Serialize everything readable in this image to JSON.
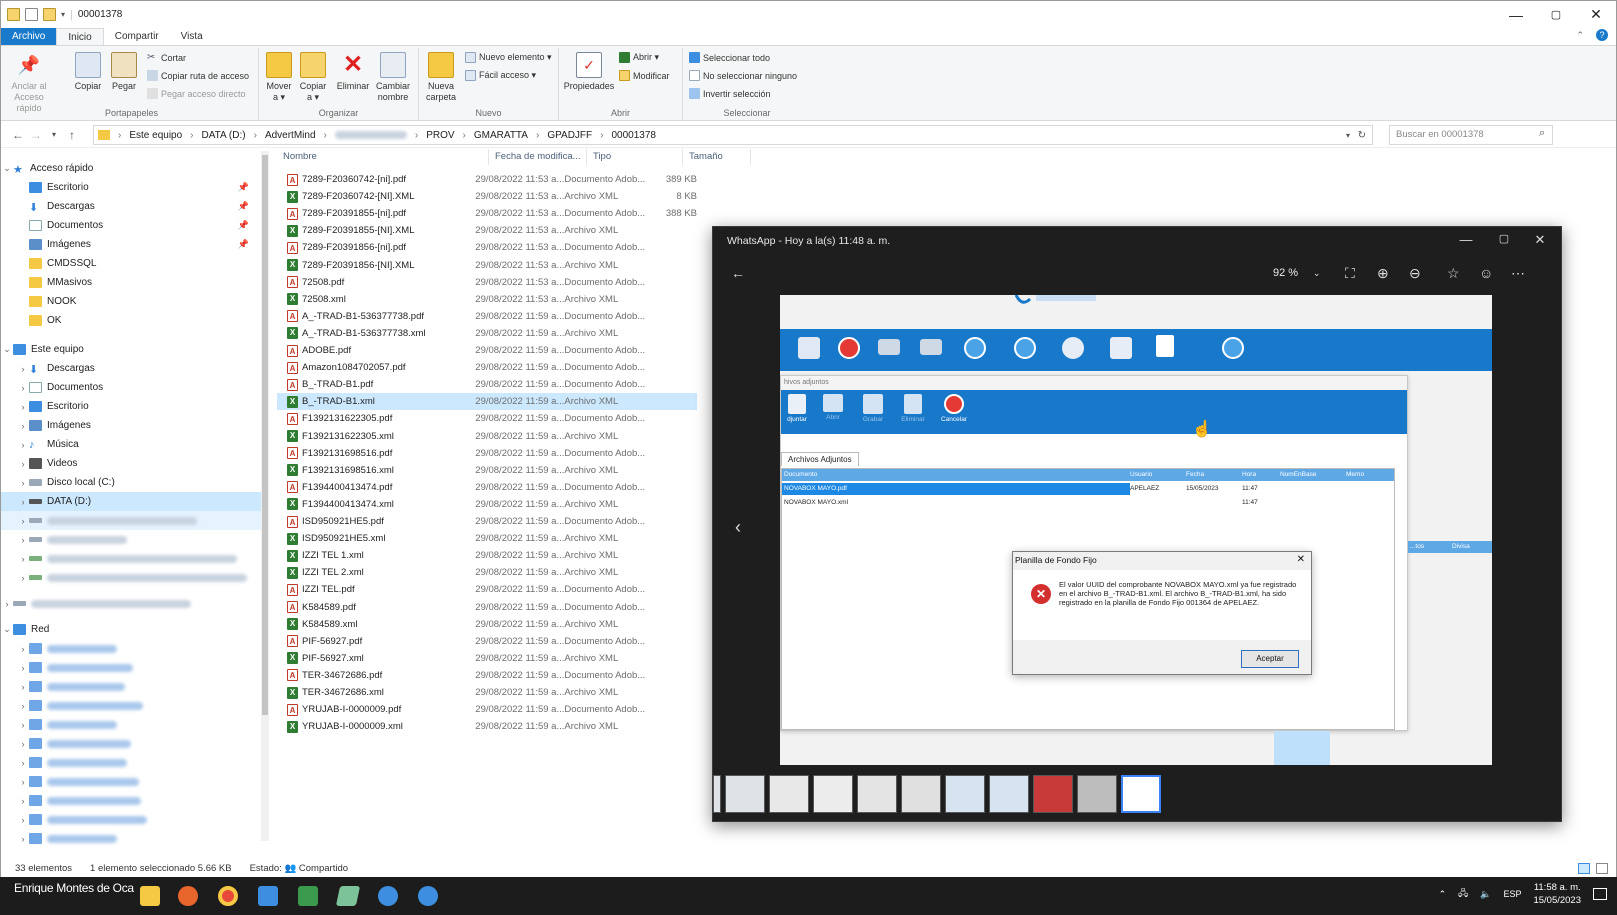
{
  "window": {
    "path_title": "00001378",
    "min": "—",
    "max": "▢",
    "close": "✕"
  },
  "ribbon_tabs": [
    "Archivo",
    "Inicio",
    "Compartir",
    "Vista"
  ],
  "ribbon": {
    "portapapeles": {
      "pin": "Anclar al Acceso rápido",
      "copy": "Copiar",
      "paste": "Pegar",
      "cut": "Cortar",
      "copy_path": "Copiar ruta de acceso",
      "paste_shortcut": "Pegar acceso directo",
      "label": "Portapapeles"
    },
    "organizar": {
      "move": "Mover a ▾",
      "copy_to": "Copiar a ▾",
      "delete": "Eliminar",
      "rename": "Cambiar nombre",
      "label": "Organizar"
    },
    "nuevo": {
      "new_folder": "Nueva carpeta",
      "new_item": "Nuevo elemento ▾",
      "easy_access": "Fácil acceso ▾",
      "label": "Nuevo"
    },
    "abrir": {
      "properties": "Propiedades",
      "open": "Abrir ▾",
      "modify": "Modificar",
      "label": "Abrir"
    },
    "seleccionar": {
      "select_all": "Seleccionar todo",
      "select_none": "No seleccionar ninguno",
      "invert": "Invertir selección",
      "label": "Seleccionar"
    }
  },
  "breadcrumb": [
    "Este equipo",
    "DATA (D:)",
    "AdvertMind",
    "PROV",
    "GMARATTA",
    "GPADJFF",
    "00001378"
  ],
  "search_placeholder": "Buscar en 00001378",
  "nav": {
    "quick_access": "Acceso rápido",
    "quick_items": [
      "Escritorio",
      "Descargas",
      "Documentos",
      "Imágenes",
      "CMDSSQL",
      "MMasivos",
      "NOOK",
      "OK"
    ],
    "this_pc": "Este equipo",
    "pc_items": [
      "Descargas",
      "Documentos",
      "Escritorio",
      "Imágenes",
      "Música",
      "Videos",
      "Disco local (C:)",
      "DATA (D:)"
    ],
    "network": "Red"
  },
  "columns": {
    "name": "Nombre",
    "date": "Fecha de modifica...",
    "type": "Tipo",
    "size": "Tamaño"
  },
  "files": [
    {
      "name": "7289-F20360742-[ni].pdf",
      "kind": "pdf",
      "date": "29/08/2022 11:53 a...",
      "type": "Documento Adob...",
      "size": "389 KB"
    },
    {
      "name": "7289-F20360742-[NI].XML",
      "kind": "xml",
      "date": "29/08/2022 11:53 a...",
      "type": "Archivo XML",
      "size": "8 KB"
    },
    {
      "name": "7289-F20391855-[ni].pdf",
      "kind": "pdf",
      "date": "29/08/2022 11:53 a...",
      "type": "Documento Adob...",
      "size": "388 KB"
    },
    {
      "name": "7289-F20391855-[NI].XML",
      "kind": "xml",
      "date": "29/08/2022 11:53 a...",
      "type": "Archivo XML",
      "size": ""
    },
    {
      "name": "7289-F20391856-[ni].pdf",
      "kind": "pdf",
      "date": "29/08/2022 11:53 a...",
      "type": "Documento Adob...",
      "size": ""
    },
    {
      "name": "7289-F20391856-[NI].XML",
      "kind": "xml",
      "date": "29/08/2022 11:53 a...",
      "type": "Archivo XML",
      "size": ""
    },
    {
      "name": "72508.pdf",
      "kind": "pdf",
      "date": "29/08/2022 11:53 a...",
      "type": "Documento Adob...",
      "size": ""
    },
    {
      "name": "72508.xml",
      "kind": "xml",
      "date": "29/08/2022 11:53 a...",
      "type": "Archivo XML",
      "size": ""
    },
    {
      "name": "A_-TRAD-B1-536377738.pdf",
      "kind": "pdf",
      "date": "29/08/2022 11:59 a...",
      "type": "Documento Adob...",
      "size": ""
    },
    {
      "name": "A_-TRAD-B1-536377738.xml",
      "kind": "xml",
      "date": "29/08/2022 11:59 a...",
      "type": "Archivo XML",
      "size": ""
    },
    {
      "name": "ADOBE.pdf",
      "kind": "pdf",
      "date": "29/08/2022 11:59 a...",
      "type": "Documento Adob...",
      "size": ""
    },
    {
      "name": "Amazon1084702057.pdf",
      "kind": "pdf",
      "date": "29/08/2022 11:59 a...",
      "type": "Documento Adob...",
      "size": ""
    },
    {
      "name": "B_-TRAD-B1.pdf",
      "kind": "pdf",
      "date": "29/08/2022 11:59 a...",
      "type": "Documento Adob...",
      "size": ""
    },
    {
      "name": "B_-TRAD-B1.xml",
      "kind": "xml",
      "date": "29/08/2022 11:59 a...",
      "type": "Archivo XML",
      "size": "",
      "selected": true
    },
    {
      "name": "F1392131622305.pdf",
      "kind": "pdf",
      "date": "29/08/2022 11:59 a...",
      "type": "Documento Adob...",
      "size": ""
    },
    {
      "name": "F1392131622305.xml",
      "kind": "xml",
      "date": "29/08/2022 11:59 a...",
      "type": "Archivo XML",
      "size": ""
    },
    {
      "name": "F1392131698516.pdf",
      "kind": "pdf",
      "date": "29/08/2022 11:59 a...",
      "type": "Documento Adob...",
      "size": ""
    },
    {
      "name": "F1392131698516.xml",
      "kind": "xml",
      "date": "29/08/2022 11:59 a...",
      "type": "Archivo XML",
      "size": ""
    },
    {
      "name": "F1394400413474.pdf",
      "kind": "pdf",
      "date": "29/08/2022 11:59 a...",
      "type": "Documento Adob...",
      "size": ""
    },
    {
      "name": "F1394400413474.xml",
      "kind": "xml",
      "date": "29/08/2022 11:59 a...",
      "type": "Archivo XML",
      "size": ""
    },
    {
      "name": "ISD950921HE5.pdf",
      "kind": "pdf",
      "date": "29/08/2022 11:59 a...",
      "type": "Documento Adob...",
      "size": ""
    },
    {
      "name": "ISD950921HE5.xml",
      "kind": "xml",
      "date": "29/08/2022 11:59 a...",
      "type": "Archivo XML",
      "size": ""
    },
    {
      "name": "IZZI TEL 1.xml",
      "kind": "xml",
      "date": "29/08/2022 11:59 a...",
      "type": "Archivo XML",
      "size": ""
    },
    {
      "name": "IZZI TEL 2.xml",
      "kind": "xml",
      "date": "29/08/2022 11:59 a...",
      "type": "Archivo XML",
      "size": ""
    },
    {
      "name": "IZZI TEL.pdf",
      "kind": "pdf",
      "date": "29/08/2022 11:59 a...",
      "type": "Documento Adob...",
      "size": ""
    },
    {
      "name": "K584589.pdf",
      "kind": "pdf",
      "date": "29/08/2022 11:59 a...",
      "type": "Documento Adob...",
      "size": ""
    },
    {
      "name": "K584589.xml",
      "kind": "xml",
      "date": "29/08/2022 11:59 a...",
      "type": "Archivo XML",
      "size": ""
    },
    {
      "name": "PIF-56927.pdf",
      "kind": "pdf",
      "date": "29/08/2022 11:59 a...",
      "type": "Documento Adob...",
      "size": ""
    },
    {
      "name": "PIF-56927.xml",
      "kind": "xml",
      "date": "29/08/2022 11:59 a...",
      "type": "Archivo XML",
      "size": ""
    },
    {
      "name": "TER-34672686.pdf",
      "kind": "pdf",
      "date": "29/08/2022 11:59 a...",
      "type": "Documento Adob...",
      "size": ""
    },
    {
      "name": "TER-34672686.xml",
      "kind": "xml",
      "date": "29/08/2022 11:59 a...",
      "type": "Archivo XML",
      "size": ""
    },
    {
      "name": "YRUJAB-I-0000009.pdf",
      "kind": "pdf",
      "date": "29/08/2022 11:59 a...",
      "type": "Documento Adob...",
      "size": ""
    },
    {
      "name": "YRUJAB-I-0000009.xml",
      "kind": "xml",
      "date": "29/08/2022 11:59 a...",
      "type": "Archivo XML",
      "size": ""
    }
  ],
  "status": {
    "count": "33 elementos",
    "selection": "1 elemento seleccionado 5.66 KB",
    "state": "Estado: 👥 Compartido"
  },
  "whatsapp": {
    "title": "WhatsApp - Hoy a la(s) 11:48 a. m.",
    "zoom": "92 %",
    "shot": {
      "tab": "Archivos Adjuntos",
      "adjuntos_label": "hivos adjuntos",
      "toolbar": [
        "djuntar",
        "Abrir",
        "Grabar",
        "Eliminar",
        "Cancelar"
      ],
      "grid_headers": [
        "Documento",
        "Usuario",
        "Fecha",
        "Hora",
        "NumEnBase",
        "Memo"
      ],
      "rows": [
        {
          "doc": "NOVABOX MAYO.pdf",
          "user": "APELAEZ",
          "date": "15/05/2023",
          "time": "11:47"
        },
        {
          "doc": "NOVABOX MAYO.xml",
          "user": "",
          "date": "",
          "time": "11:47"
        }
      ],
      "right_headers": [
        "...tos",
        "Divisa"
      ]
    },
    "dialog": {
      "title": "Planilla de Fondo Fijo",
      "message": "El valor UUID del comprobante NOVABOX MAYO.xml ya fue registrado en el archivo B_-TRAD-B1.xml. El archivo B_-TRAD-B1.xml, ha sido registrado en la planilla de Fondo Fijo 001364 de APELAEZ.",
      "button": "Aceptar"
    }
  },
  "taskbar": {
    "user": "Enrique Montes de Oca",
    "lang": "ESP",
    "time": "11:58 a. m.",
    "date": "15/05/2023"
  }
}
